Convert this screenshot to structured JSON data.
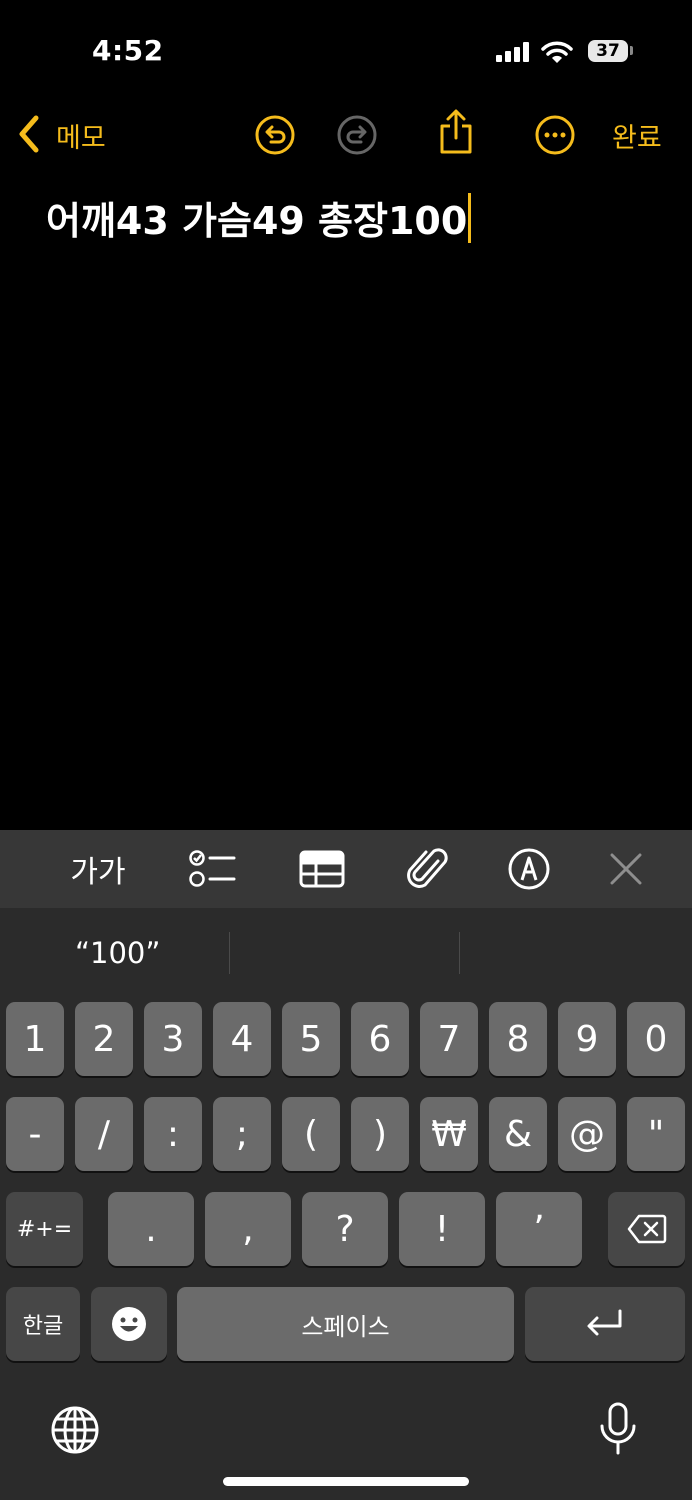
{
  "status_bar": {
    "time": "4:52",
    "battery": "37"
  },
  "nav": {
    "back_label": "메모",
    "done_label": "완료"
  },
  "note": {
    "text": "어깨43 가슴49 총장100"
  },
  "toolbar": {
    "format_label": "가가"
  },
  "suggestions": [
    "“100”",
    "",
    ""
  ],
  "keyboard": {
    "row1": [
      "1",
      "2",
      "3",
      "4",
      "5",
      "6",
      "7",
      "8",
      "9",
      "0"
    ],
    "row2": [
      "-",
      "/",
      ":",
      ";",
      "(",
      ")",
      "₩",
      "&",
      "@",
      "\""
    ],
    "row3_mode": "#+=",
    "row3": [
      ".",
      ",",
      "?",
      "!",
      "’"
    ],
    "row4_lang": "한글",
    "space_label": "스페이스"
  },
  "colors": {
    "accent": "#f5bc1c",
    "keyboard_bg": "#2b2b2b",
    "key_bg": "#6b6b6b",
    "key_dark_bg": "#474747"
  }
}
